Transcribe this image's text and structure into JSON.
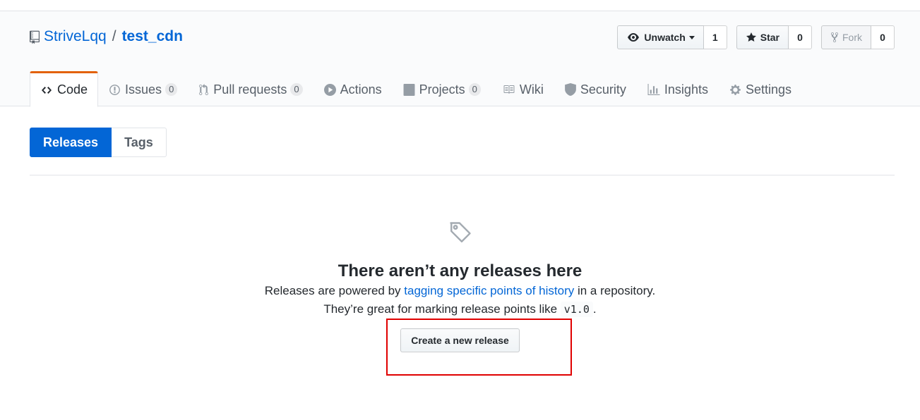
{
  "repo": {
    "owner": "StriveLqq",
    "separator": "/",
    "name": "test_cdn"
  },
  "actions": {
    "watch_label": "Unwatch",
    "watch_count": "1",
    "star_label": "Star",
    "star_count": "0",
    "fork_label": "Fork",
    "fork_count": "0"
  },
  "nav": {
    "code": "Code",
    "issues": "Issues",
    "issues_count": "0",
    "pulls": "Pull requests",
    "pulls_count": "0",
    "actions": "Actions",
    "projects": "Projects",
    "projects_count": "0",
    "wiki": "Wiki",
    "security": "Security",
    "insights": "Insights",
    "settings": "Settings"
  },
  "subnav": {
    "releases": "Releases",
    "tags": "Tags"
  },
  "blankslate": {
    "title": "There aren’t any releases here",
    "line1_before": "Releases are powered by ",
    "line1_link": "tagging specific points of history",
    "line1_after": " in a repository.",
    "line2_before": "They’re great for marking release points like ",
    "line2_code": "v1.0",
    "line2_after": ".",
    "button": "Create a new release"
  },
  "colors": {
    "accent": "#0366d6",
    "nav_selected_border": "#e36209",
    "highlight": "#e00000"
  }
}
